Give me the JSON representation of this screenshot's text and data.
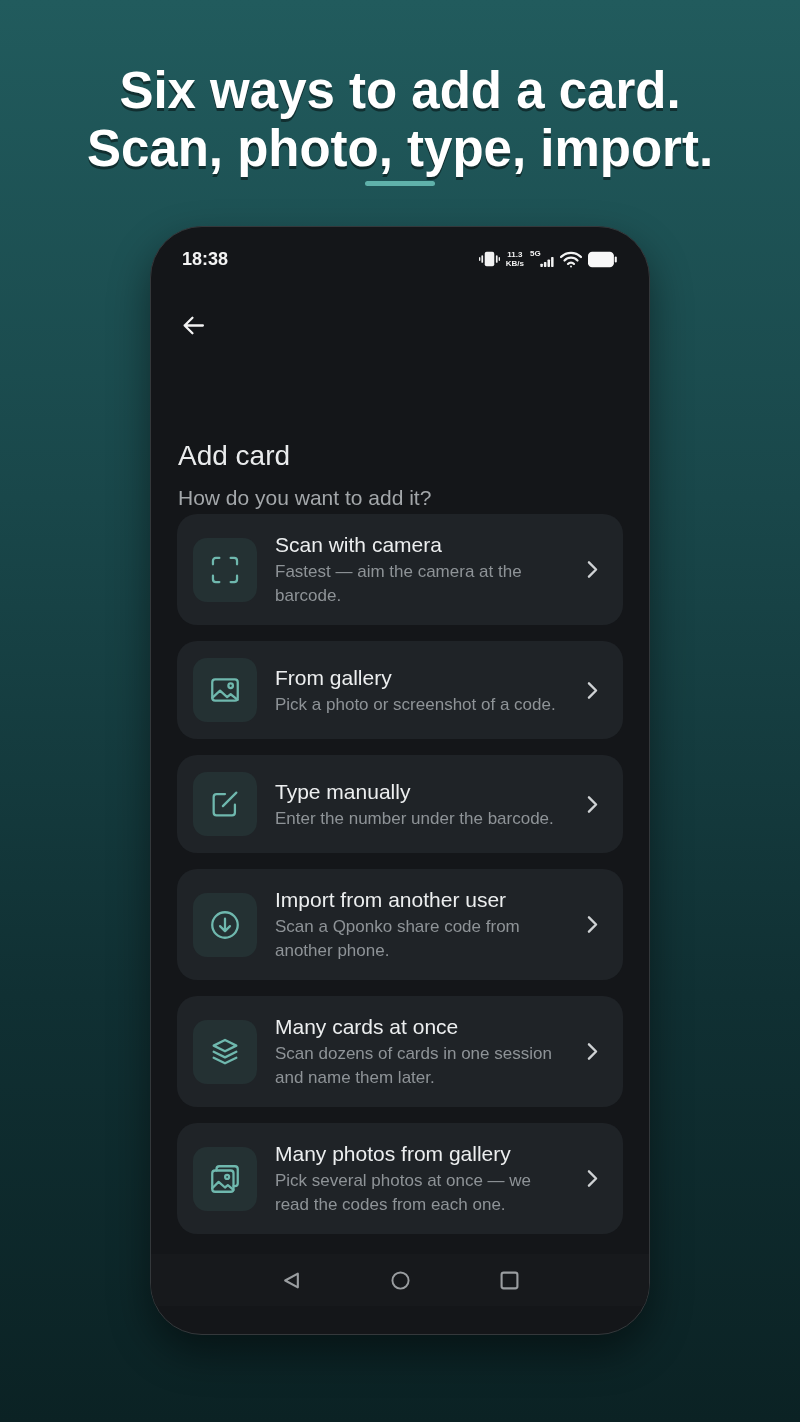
{
  "headline": {
    "lines": [
      "Six ways to add a card.",
      "Scan, photo, type, import."
    ]
  },
  "status_bar": {
    "time": "18:38",
    "speed_value": "11.3",
    "speed_unit": "KB/s",
    "network": "5G"
  },
  "screen": {
    "title": "Add card",
    "subtitle": "How do you want to add it?"
  },
  "options": [
    {
      "title": "Scan with camera",
      "description": "Fastest — aim the camera at the barcode."
    },
    {
      "title": "From gallery",
      "description": "Pick a photo or screenshot of a code."
    },
    {
      "title": "Type manually",
      "description": "Enter the number under the barcode."
    },
    {
      "title": "Import from another user",
      "description": "Scan a Qponko share code from another phone."
    },
    {
      "title": "Many cards at once",
      "description": "Scan dozens of cards in one session and name them later."
    },
    {
      "title": "Many photos from gallery",
      "description": "Pick several photos at once — we read the codes from each one."
    }
  ]
}
